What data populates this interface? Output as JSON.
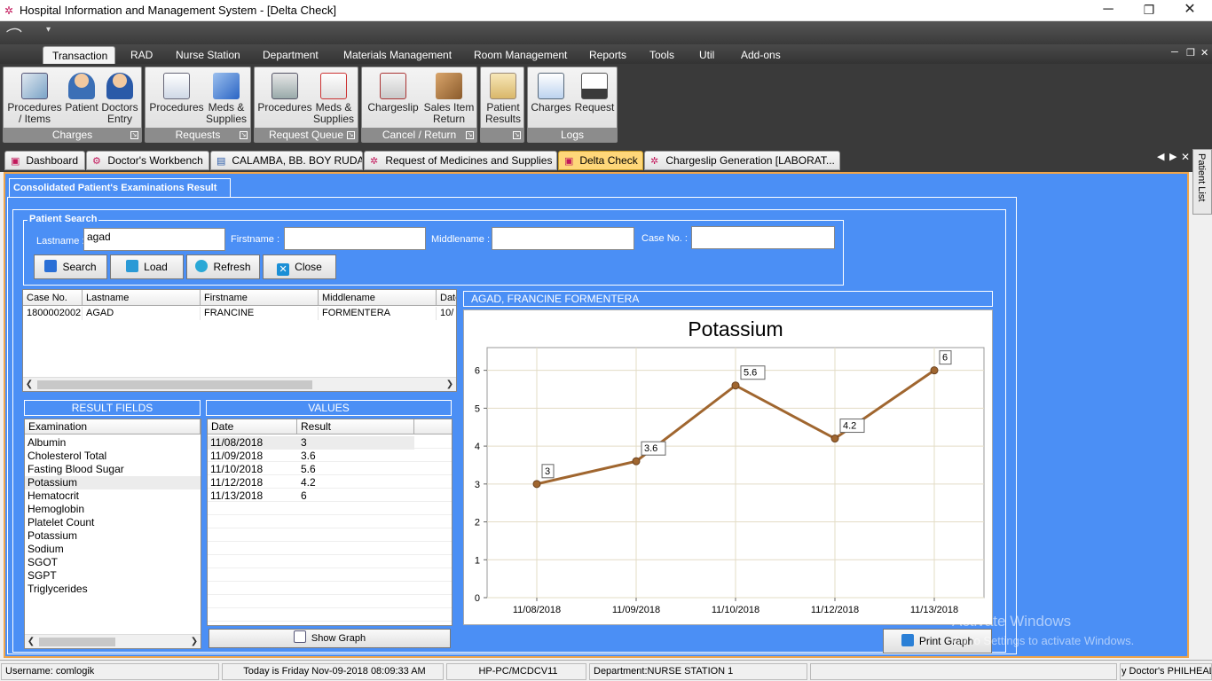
{
  "window": {
    "title": "Hospital Information and Management System - [Delta Check]",
    "min": "─",
    "restore": "❐",
    "close": "✕"
  },
  "menu": {
    "tabs": [
      "Transaction",
      "RAD",
      "Nurse Station",
      "Department",
      "Materials Management",
      "Room Management",
      "Reports",
      "Tools",
      "Util",
      "Add-ons"
    ]
  },
  "ribbon": {
    "groups": [
      {
        "caption": "Charges",
        "buttons": [
          "Procedures / Items",
          "Patient",
          "Doctors Entry"
        ]
      },
      {
        "caption": "Requests",
        "buttons": [
          "Procedures",
          "Meds & Supplies"
        ]
      },
      {
        "caption": "Request Queue",
        "buttons": [
          "Procedures",
          "Meds & Supplies"
        ]
      },
      {
        "caption": "Cancel / Return",
        "buttons": [
          "Chargeslip",
          "Sales Item Return"
        ]
      },
      {
        "caption": "",
        "buttons": [
          "Patient Results"
        ]
      },
      {
        "caption": "Logs",
        "buttons": [
          "Charges",
          "Request"
        ]
      }
    ]
  },
  "doc_tabs": [
    "Dashboard",
    "Doctor's Workbench",
    "CALAMBA, BB. BOY RUDA",
    "Request of Medicines and Supplies",
    "Delta Check",
    "Chargeslip Generation [LABORAT..."
  ],
  "side_panel": "Patient List",
  "form": {
    "tab_title": "Consolidated Patient's Examinations Result",
    "search_legend": "Patient Search",
    "labels": {
      "lastname": "Lastname :",
      "firstname": "Firstname :",
      "middlename": "Middlename :",
      "caseno": "Case No. :"
    },
    "values": {
      "lastname": "agad",
      "firstname": "",
      "middlename": "",
      "caseno": ""
    },
    "buttons": {
      "search": "Search",
      "load": "Load",
      "refresh": "Refresh",
      "close": "Close",
      "show_graph": "Show Graph",
      "print_graph": "Print Graph"
    }
  },
  "patients": {
    "columns": [
      "Case No.",
      "Lastname",
      "Firstname",
      "Middlename",
      "Date"
    ],
    "rows": [
      [
        "1800002002",
        "AGAD",
        "FRANCINE",
        "FORMENTERA",
        "10/"
      ]
    ]
  },
  "result_fields": {
    "title": "RESULT FIELDS",
    "column": "Examination",
    "items": [
      "Albumin",
      "Cholesterol Total",
      "Fasting Blood Sugar",
      "Potassium",
      "Hematocrit",
      "Hemoglobin",
      "Platelet Count",
      "Potassium",
      "Sodium",
      "SGOT",
      "SGPT",
      "Triglycerides"
    ],
    "selected_index": 3
  },
  "values_panel": {
    "title": "VALUES",
    "columns": [
      "Date",
      "Result"
    ],
    "rows": [
      [
        "11/08/2018",
        "3"
      ],
      [
        "11/09/2018",
        "3.6"
      ],
      [
        "11/10/2018",
        "5.6"
      ],
      [
        "11/12/2018",
        "4.2"
      ],
      [
        "11/13/2018",
        "6"
      ]
    ]
  },
  "chart_header": "AGAD, FRANCINE FORMENTERA",
  "chart_data": {
    "type": "line",
    "title": "Potassium",
    "categories": [
      "11/08/2018",
      "11/09/2018",
      "11/10/2018",
      "11/12/2018",
      "11/13/2018"
    ],
    "values": [
      3,
      3.6,
      5.6,
      4.2,
      6
    ],
    "labels": [
      "3",
      "3.6",
      "5.6",
      "4.2",
      "6"
    ],
    "y_ticks": [
      "0",
      "1",
      "2",
      "3",
      "4",
      "5",
      "6"
    ],
    "ylim": [
      0,
      6.6
    ],
    "grid": true,
    "line_color": "#a0662f"
  },
  "watermark": {
    "line1": "Activate Windows",
    "line2": "Go to Settings to activate Windows."
  },
  "status": {
    "username": "Username: comlogik",
    "today": "Today is Friday Nov-09-2018 08:09:33 AM",
    "host": "HP-PC/MCDCV11",
    "department": "Department:NURSE STATION 1",
    "extra": "",
    "scroll": "y Doctor's PHILHEALTH"
  }
}
